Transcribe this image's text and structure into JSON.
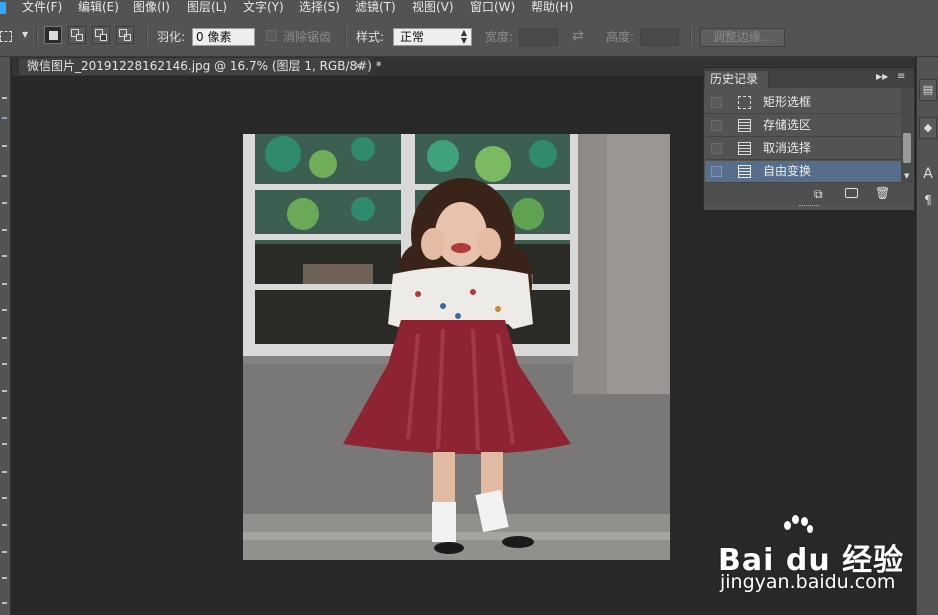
{
  "menu": [
    "文件(F)",
    "编辑(E)",
    "图像(I)",
    "图层(L)",
    "文字(Y)",
    "选择(S)",
    "滤镜(T)",
    "视图(V)",
    "窗口(W)",
    "帮助(H)"
  ],
  "options": {
    "feather_label": "羽化:",
    "feather_value": "0 像素",
    "antialias_label": "消除锯齿",
    "style_label": "样式:",
    "style_value": "正常",
    "width_label": "宽度:",
    "height_label": "高度:",
    "refine_edge_label": "调整边缘..."
  },
  "document": {
    "tab_title": "微信图片_20191228162146.jpg @ 16.7% (图层 1, RGB/8#) *",
    "close_glyph": "×"
  },
  "history_panel": {
    "title": "历史记录",
    "items": [
      {
        "label": "矩形选框",
        "icon": "rect-marquee-icon",
        "selected": false
      },
      {
        "label": "存储选区",
        "icon": "document-icon",
        "selected": false
      },
      {
        "label": "取消选择",
        "icon": "document-icon",
        "selected": false
      },
      {
        "label": "自由变换",
        "icon": "document-icon",
        "selected": true
      }
    ],
    "footer_icons": [
      "new-document-from-state-icon",
      "camera-icon",
      "trash-icon"
    ]
  },
  "right_dock": [
    "history-panel-icon",
    "3d-cube-icon",
    "text-icon",
    "paragraph-icon"
  ],
  "watermark": {
    "brand": "Bai du 经验",
    "url": "jingyan.baidu.com"
  },
  "colors": {
    "chrome": "#535353",
    "canvas": "#282828",
    "selection": "#566e8a"
  }
}
